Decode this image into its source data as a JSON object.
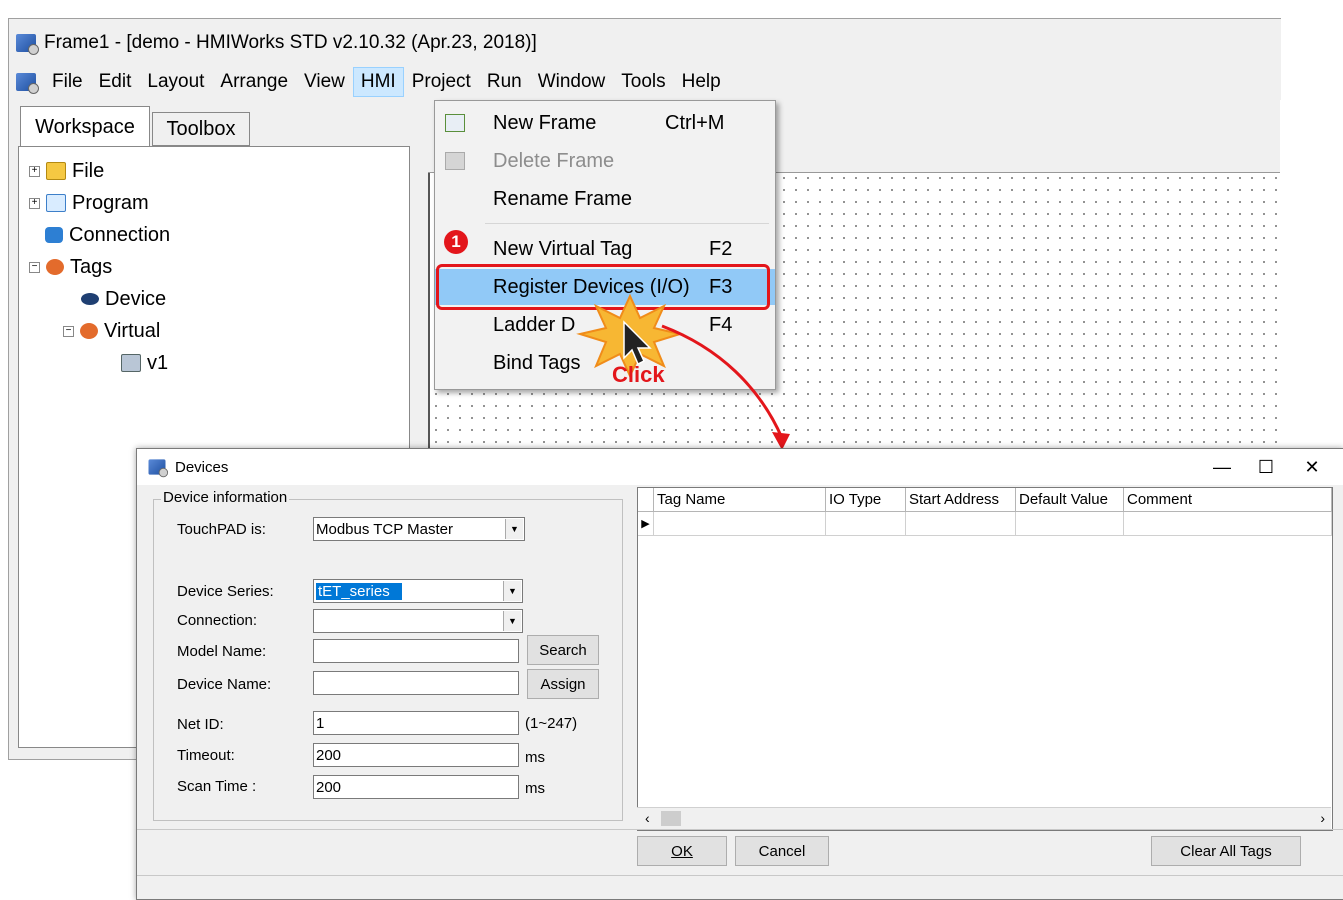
{
  "main_window": {
    "title": "Frame1 - [demo - HMIWorks STD v2.10.32 (Apr.23, 2018)]",
    "menu": [
      "File",
      "Edit",
      "Layout",
      "Arrange",
      "View",
      "HMI",
      "Project",
      "Run",
      "Window",
      "Tools",
      "Help"
    ],
    "active_menu": "HMI"
  },
  "workspace": {
    "tabs": [
      "Workspace",
      "Toolbox"
    ],
    "tree": {
      "file": "File",
      "program": "Program",
      "connection": "Connection",
      "tags": "Tags",
      "device": "Device",
      "virtual": "Virtual",
      "v1": "v1"
    }
  },
  "hmi_menu": {
    "items": [
      {
        "label": "New Frame",
        "shortcut": "Ctrl+M"
      },
      {
        "label": "Delete Frame",
        "shortcut": ""
      },
      {
        "label": "Rename Frame",
        "shortcut": ""
      },
      {
        "label": "New Virtual Tag",
        "shortcut": "F2"
      },
      {
        "label": "Register Devices (I/O)",
        "shortcut": "F3"
      },
      {
        "label": "Ladder D",
        "shortcut": "F4"
      },
      {
        "label": "Bind Tags",
        "shortcut": ""
      }
    ]
  },
  "annotations": {
    "step_number": "1",
    "click_label": "Click",
    "accent_color": "#e3161b"
  },
  "devices_dialog": {
    "title": "Devices",
    "group_label": "Device information",
    "fields": {
      "touchpad_label": "TouchPAD is:",
      "touchpad_value": "Modbus TCP Master",
      "series_label": "Device Series:",
      "series_value": "tET_series",
      "connection_label": "Connection:",
      "connection_value": "",
      "model_label": "Model Name:",
      "model_value": "",
      "device_name_label": "Device Name:",
      "device_name_value": "",
      "netid_label": "Net ID:",
      "netid_value": "1",
      "netid_range": "(1~247)",
      "timeout_label": "Timeout:",
      "timeout_value": "200",
      "timeout_unit": "ms",
      "scan_label": "Scan Time :",
      "scan_value": "200",
      "scan_unit": "ms"
    },
    "buttons": {
      "search": "Search",
      "assign": "Assign",
      "ok": "OK",
      "cancel": "Cancel",
      "clear_all": "Clear All Tags"
    },
    "grid_columns": [
      "Tag Name",
      "IO Type",
      "Start Address",
      "Default Value",
      "Comment"
    ]
  }
}
